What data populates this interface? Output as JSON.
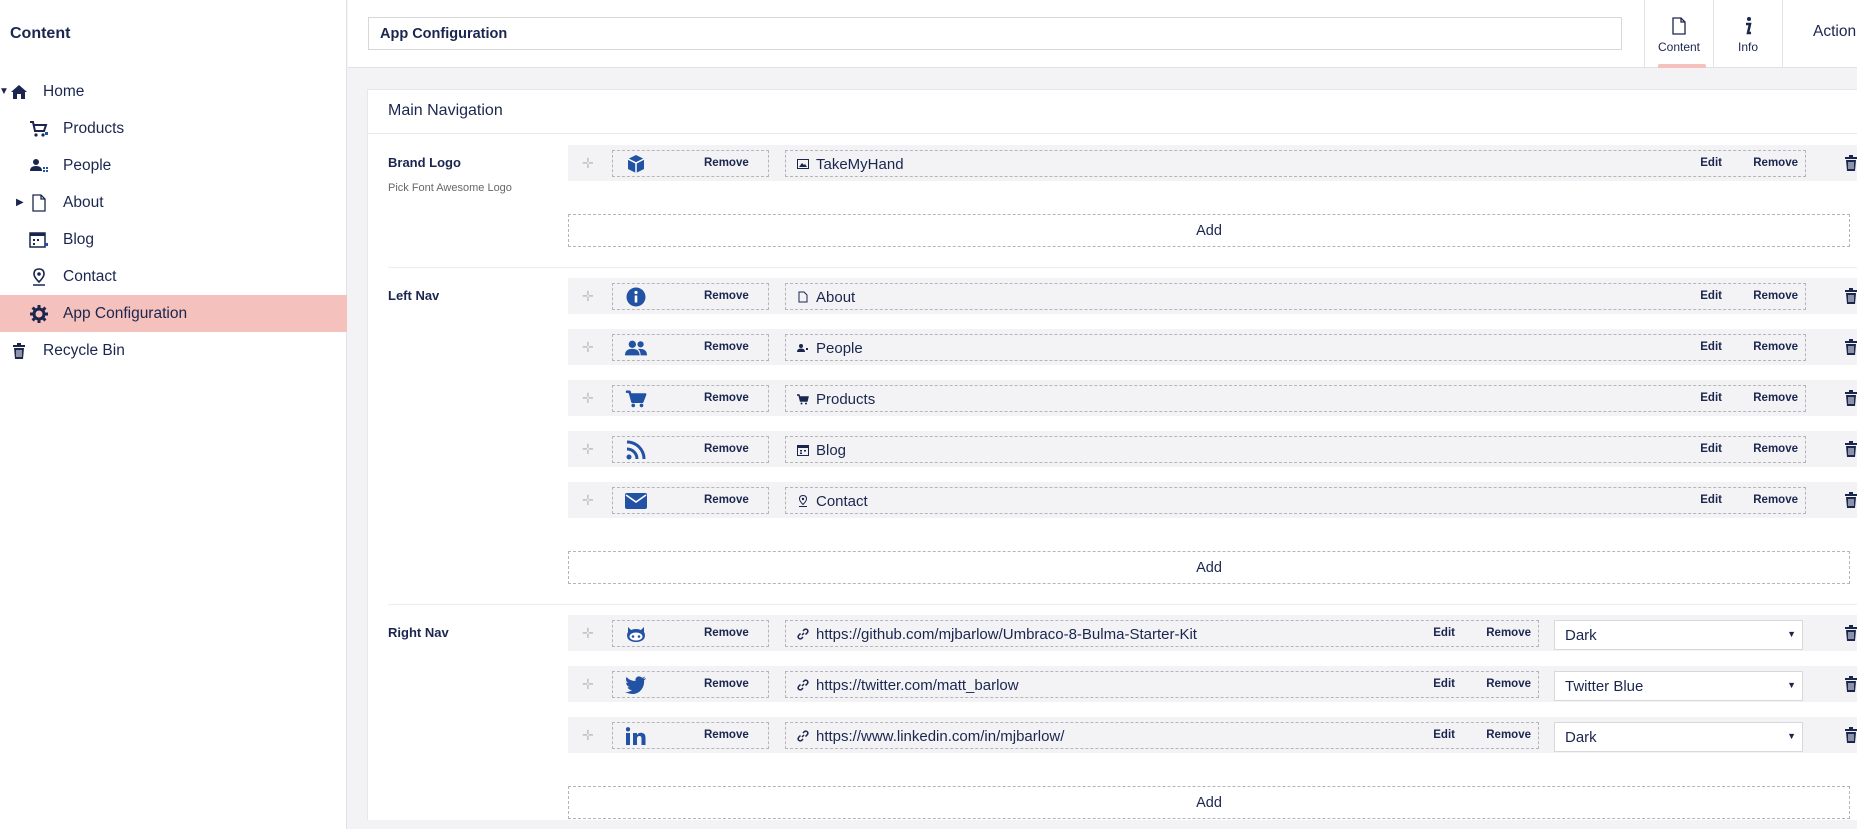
{
  "sidebar": {
    "title": "Content",
    "items": [
      {
        "label": "Home",
        "icon": "home-icon"
      },
      {
        "label": "Products",
        "icon": "cart-icon"
      },
      {
        "label": "People",
        "icon": "people-icon"
      },
      {
        "label": "About",
        "icon": "document-icon"
      },
      {
        "label": "Blog",
        "icon": "calendar-icon"
      },
      {
        "label": "Contact",
        "icon": "map-pin-icon"
      },
      {
        "label": "App Configuration",
        "icon": "gear-icon"
      },
      {
        "label": "Recycle Bin",
        "icon": "trash-icon"
      }
    ]
  },
  "header": {
    "name_value": "App Configuration",
    "apps": [
      {
        "label": "Content"
      },
      {
        "label": "Info"
      }
    ],
    "actions_label": "Action"
  },
  "panel": {
    "title": "Main Navigation",
    "remove_label": "Remove",
    "edit_label": "Edit",
    "add_label": "Add",
    "brand_logo": {
      "label": "Brand Logo",
      "description": "Pick Font Awesome Logo",
      "rows": [
        {
          "icon": "cube-icon",
          "link": "TakeMyHand"
        }
      ]
    },
    "left_nav": {
      "label": "Left Nav",
      "rows": [
        {
          "icon": "info-circle-icon",
          "link": "About"
        },
        {
          "icon": "users-icon",
          "link": "People"
        },
        {
          "icon": "cart-icon",
          "link": "Products"
        },
        {
          "icon": "rss-icon",
          "link": "Blog"
        },
        {
          "icon": "envelope-icon",
          "link": "Contact"
        }
      ]
    },
    "right_nav": {
      "label": "Right Nav",
      "rows": [
        {
          "icon": "github-icon",
          "link": "https://github.com/mjbarlow/Umbraco-8-Bulma-Starter-Kit",
          "theme": "Dark"
        },
        {
          "icon": "twitter-icon",
          "link": "https://twitter.com/matt_barlow",
          "theme": "Twitter Blue"
        },
        {
          "icon": "linkedin-icon",
          "link": "https://www.linkedin.com/in/mjbarlow/",
          "theme": "Dark"
        }
      ]
    }
  },
  "colors": {
    "accent": "#f5c1bc",
    "icon_blue": "#2152a3",
    "text": "#1b264f"
  }
}
